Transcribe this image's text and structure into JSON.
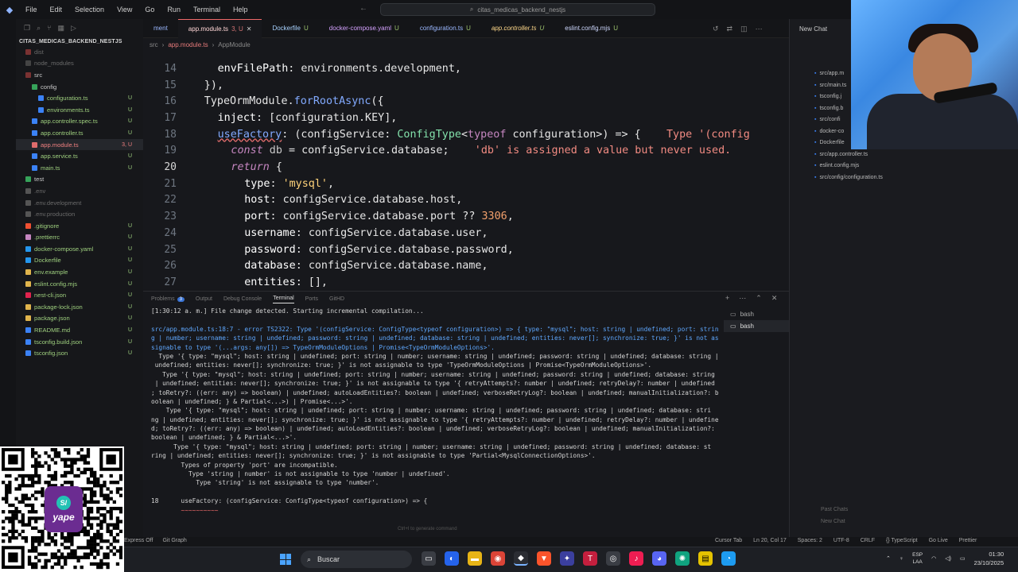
{
  "titlebar": {
    "menus": [
      "File",
      "Edit",
      "Selection",
      "View",
      "Go",
      "Run",
      "Terminal",
      "Help"
    ],
    "command_center": "citas_medicas_backend_nestjs"
  },
  "sidebar": {
    "project": "CITAS_MEDICAS_BACKEND_NESTJS",
    "items": [
      {
        "label": "dist",
        "status": "",
        "color": "#7a3232",
        "dim": true
      },
      {
        "label": "node_modules",
        "status": "",
        "color": "#444",
        "dim": true
      },
      {
        "label": "src",
        "status": "",
        "color": "#7a3232",
        "dim": false
      },
      {
        "label": "config",
        "status": "",
        "color": "#36a35a",
        "dim": false
      },
      {
        "label": "configuration.ts",
        "status": "U",
        "color": "#3b82f6",
        "dim": false
      },
      {
        "label": "environments.ts",
        "status": "U",
        "color": "#3b82f6",
        "dim": false
      },
      {
        "label": "app.controller.spec.ts",
        "status": "U",
        "color": "#3b82f6",
        "dim": false
      },
      {
        "label": "app.controller.ts",
        "status": "U",
        "color": "#3b82f6",
        "dim": false
      },
      {
        "label": "app.module.ts",
        "status": "3, U",
        "color": "#e06c6c",
        "dim": false
      },
      {
        "label": "app.service.ts",
        "status": "U",
        "color": "#3b82f6",
        "dim": false
      },
      {
        "label": "main.ts",
        "status": "U",
        "color": "#3b82f6",
        "dim": false
      },
      {
        "label": "test",
        "status": "",
        "color": "#36a35a",
        "dim": false
      },
      {
        "label": ".env",
        "status": "",
        "color": "#555",
        "dim": true
      },
      {
        "label": ".env.development",
        "status": "",
        "color": "#555",
        "dim": true
      },
      {
        "label": ".env.production",
        "status": "",
        "color": "#555",
        "dim": true
      },
      {
        "label": ".gitignore",
        "status": "U",
        "color": "#f05032",
        "dim": false
      },
      {
        "label": ".prettierrc",
        "status": "U",
        "color": "#c586c0",
        "dim": false
      },
      {
        "label": "docker-compose.yaml",
        "status": "U",
        "color": "#2496ed",
        "dim": false
      },
      {
        "label": "Dockerfile",
        "status": "U",
        "color": "#2496ed",
        "dim": false
      },
      {
        "label": "env.example",
        "status": "U",
        "color": "#e0b44c",
        "dim": false
      },
      {
        "label": "eslint.config.mjs",
        "status": "U",
        "color": "#e0b44c",
        "dim": false
      },
      {
        "label": "nest-cli.json",
        "status": "U",
        "color": "#e0234e",
        "dim": false
      },
      {
        "label": "package-lock.json",
        "status": "U",
        "color": "#e0b44c",
        "dim": false
      },
      {
        "label": "package.json",
        "status": "U",
        "color": "#e0b44c",
        "dim": false
      },
      {
        "label": "README.md",
        "status": "U",
        "color": "#3b82f6",
        "dim": false
      },
      {
        "label": "tsconfig.build.json",
        "status": "U",
        "color": "#3b82f6",
        "dim": false
      },
      {
        "label": "tsconfig.json",
        "status": "U",
        "color": "#3b82f6",
        "dim": false
      }
    ]
  },
  "tabs": [
    {
      "label": "ment",
      "status": "",
      "cls": "cfg"
    },
    {
      "label": "app.module.ts",
      "status": "3, U",
      "cls": "active"
    },
    {
      "label": "Dockerfile",
      "status": "U",
      "cls": "docker"
    },
    {
      "label": "docker-compose.yaml",
      "status": "U",
      "cls": "yaml"
    },
    {
      "label": "configuration.ts",
      "status": "U",
      "cls": "cfg"
    },
    {
      "label": "app.controller.ts",
      "status": "U",
      "cls": "ctrl"
    },
    {
      "label": "eslint.config.mjs",
      "status": "U",
      "cls": "eslint"
    }
  ],
  "breadcrumb": [
    "src",
    "app.module.ts",
    "AppModule"
  ],
  "editor": {
    "lines": [
      {
        "n": "14",
        "indent": 2,
        "tokens": [
          [
            "envFilePath",
            "pr"
          ],
          [
            ": ",
            "tx"
          ],
          [
            "environments",
            "tx"
          ],
          [
            ".",
            "tx"
          ],
          [
            "development",
            "tx"
          ],
          [
            ",",
            "tx"
          ]
        ]
      },
      {
        "n": "15",
        "indent": 1,
        "tokens": [
          [
            "}),",
            "tx"
          ]
        ]
      },
      {
        "n": "16",
        "indent": 1,
        "tokens": [
          [
            "TypeOrmModule",
            "tx"
          ],
          [
            ".",
            "tx"
          ],
          [
            "forRootAsync",
            "fn"
          ],
          [
            "({",
            "tx"
          ]
        ]
      },
      {
        "n": "17",
        "indent": 2,
        "tokens": [
          [
            "inject",
            "pr"
          ],
          [
            ": [",
            "tx"
          ],
          [
            "configuration",
            "tx"
          ],
          [
            ".",
            "tx"
          ],
          [
            "KEY",
            "tx"
          ],
          [
            "],",
            "tx"
          ]
        ]
      },
      {
        "n": "18",
        "indent": 2,
        "tokens": [
          [
            "useFactory",
            "fn"
          ],
          [
            ": (",
            "tx"
          ],
          [
            "configService",
            "tx"
          ],
          [
            ": ",
            "tx"
          ],
          [
            "ConfigType",
            "ty"
          ],
          [
            "<",
            "tx"
          ],
          [
            "typeof",
            "kw"
          ],
          [
            " configuration",
            ""
          ],
          [
            ">) => {",
            "tx"
          ],
          [
            "    Type '(config",
            "err"
          ]
        ]
      },
      {
        "n": "19",
        "indent": 3,
        "tokens": [
          [
            "const",
            "kw"
          ],
          [
            " db ",
            "dimt"
          ],
          [
            "= ",
            "tx"
          ],
          [
            "configService",
            "tx"
          ],
          [
            ".",
            "tx"
          ],
          [
            "database",
            "tx"
          ],
          [
            ";",
            "tx"
          ],
          [
            "    'db' is assigned a value but never used.",
            "err"
          ]
        ]
      },
      {
        "n": "20",
        "indent": 3,
        "tokens": [
          [
            "return",
            "kw"
          ],
          [
            " {",
            "tx"
          ]
        ]
      },
      {
        "n": "21",
        "indent": 4,
        "tokens": [
          [
            "type",
            "pr"
          ],
          [
            ": ",
            "tx"
          ],
          [
            "'mysql'",
            "st2"
          ],
          [
            ",",
            "tx"
          ]
        ]
      },
      {
        "n": "22",
        "indent": 4,
        "tokens": [
          [
            "host",
            "pr"
          ],
          [
            ": ",
            "tx"
          ],
          [
            "configService",
            "tx"
          ],
          [
            ".",
            "tx"
          ],
          [
            "database",
            "tx"
          ],
          [
            ".",
            "tx"
          ],
          [
            "host",
            "tx"
          ],
          [
            ",",
            "tx"
          ]
        ]
      },
      {
        "n": "23",
        "indent": 4,
        "tokens": [
          [
            "port",
            "pr"
          ],
          [
            ": ",
            "tx"
          ],
          [
            "configService",
            "tx"
          ],
          [
            ".",
            "tx"
          ],
          [
            "database",
            "tx"
          ],
          [
            ".",
            "tx"
          ],
          [
            "port",
            "tx"
          ],
          [
            " ?? ",
            "tx"
          ],
          [
            "3306",
            "nb"
          ],
          [
            ",",
            "tx"
          ]
        ]
      },
      {
        "n": "24",
        "indent": 4,
        "tokens": [
          [
            "username",
            "pr"
          ],
          [
            ": ",
            "tx"
          ],
          [
            "configService",
            "tx"
          ],
          [
            ".",
            "tx"
          ],
          [
            "database",
            "tx"
          ],
          [
            ".",
            "tx"
          ],
          [
            "user",
            "tx"
          ],
          [
            ",",
            "tx"
          ]
        ]
      },
      {
        "n": "25",
        "indent": 4,
        "tokens": [
          [
            "password",
            "pr"
          ],
          [
            ": ",
            "tx"
          ],
          [
            "configService",
            "tx"
          ],
          [
            ".",
            "tx"
          ],
          [
            "database",
            "tx"
          ],
          [
            ".",
            "tx"
          ],
          [
            "password",
            "tx"
          ],
          [
            ",",
            "tx"
          ]
        ]
      },
      {
        "n": "26",
        "indent": 4,
        "tokens": [
          [
            "database",
            "pr"
          ],
          [
            ": ",
            "tx"
          ],
          [
            "configService",
            "tx"
          ],
          [
            ".",
            "tx"
          ],
          [
            "database",
            "tx"
          ],
          [
            ".",
            "tx"
          ],
          [
            "name",
            "tx"
          ],
          [
            ",",
            "tx"
          ]
        ]
      },
      {
        "n": "27",
        "indent": 4,
        "tokens": [
          [
            "entities",
            "pr"
          ],
          [
            ": [],",
            "tx"
          ]
        ]
      }
    ]
  },
  "chat": {
    "new_chat": "New Chat",
    "files": [
      "src/app.m",
      "src/main.ts",
      "tsconfig.j",
      "tsconfig.b",
      "src/confi",
      "docker-co",
      "Dockerfile",
      "src/app.controller.ts",
      "eslint.config.mjs",
      "src/config/configuration.ts"
    ],
    "past_chats": "Past Chats",
    "new_chat_bottom": "New Chat"
  },
  "panel": {
    "tabs": [
      "Problems",
      "Output",
      "Debug Console",
      "Terminal",
      "Ports",
      "GitHD"
    ],
    "problems_count": "3",
    "active_tab": "Terminal",
    "terminals": [
      "bash",
      "bash"
    ],
    "terminal_lines": [
      {
        "t": "[1:30:12 a. m.] File change detected. Starting incremental compilation...",
        "c": ""
      },
      {
        "t": "",
        "c": ""
      },
      {
        "t": "src/app.module.ts:18:7 - error TS2322: Type '(configService: ConfigType<typeof configuration>) => { type: \"mysql\"; host: string | undefined; port: strin",
        "c": "err"
      },
      {
        "t": "g | number; username: string | undefined; password: string | undefined; database: string | undefined; entities: never[]; synchronize: true; }' is not as",
        "c": "blue"
      },
      {
        "t": "signable to type '(...args: any[]) => TypeOrmModuleOptions | Promise<TypeOrmModuleOptions>'.",
        "c": "blue"
      },
      {
        "t": "  Type '{ type: \"mysql\"; host: string | undefined; port: string | number; username: string | undefined; password: string | undefined; database: string |",
        "c": ""
      },
      {
        "t": " undefined; entities: never[]; synchronize: true; }' is not assignable to type 'TypeOrmModuleOptions | Promise<TypeOrmModuleOptions>'.",
        "c": ""
      },
      {
        "t": "   Type '{ type: \"mysql\"; host: string | undefined; port: string | number; username: string | undefined; password: string | undefined; database: string",
        "c": ""
      },
      {
        "t": " | undefined; entities: never[]; synchronize: true; }' is not assignable to type '{ retryAttempts?: number | undefined; retryDelay?: number | undefined",
        "c": ""
      },
      {
        "t": "; toRetry?: ((err: any) => boolean) | undefined; autoLoadEntities?: boolean | undefined; verboseRetryLog?: boolean | undefined; manualInitialization?: b",
        "c": ""
      },
      {
        "t": "oolean | undefined; } & Partial<...>) | Promise<...>'.",
        "c": ""
      },
      {
        "t": "    Type '{ type: \"mysql\"; host: string | undefined; port: string | number; username: string | undefined; password: string | undefined; database: stri",
        "c": ""
      },
      {
        "t": "ng | undefined; entities: never[]; synchronize: true; }' is not assignable to type '{ retryAttempts?: number | undefined; retryDelay?: number | undefine",
        "c": ""
      },
      {
        "t": "d; toRetry?: ((err: any) => boolean) | undefined; autoLoadEntities?: boolean | undefined; verboseRetryLog?: boolean | undefined; manualInitialization?:",
        "c": ""
      },
      {
        "t": "boolean | undefined; } & Partial<...>'.",
        "c": ""
      },
      {
        "t": "      Type '{ type: \"mysql\"; host: string | undefined; port: string | number; username: string | undefined; password: string | undefined; database: st",
        "c": ""
      },
      {
        "t": "ring | undefined; entities: never[]; synchronize: true; }' is not assignable to type 'Partial<MysqlConnectionOptions>'.",
        "c": ""
      },
      {
        "t": "        Types of property 'port' are incompatible.",
        "c": ""
      },
      {
        "t": "          Type 'string | number' is not assignable to type 'number | undefined'.",
        "c": ""
      },
      {
        "t": "            Type 'string' is not assignable to type 'number'.",
        "c": ""
      },
      {
        "t": "",
        "c": ""
      },
      {
        "t": "18      useFactory: (configService: ConfigType<typeof configuration>) => {",
        "c": ""
      },
      {
        "t": "        ~~~~~~~~~~",
        "c": "err"
      }
    ],
    "hint": "Ctrl+I to generate command"
  },
  "statusbar": {
    "left": [
      "Express Off",
      "Git Graph"
    ],
    "right": [
      "Cursor Tab",
      "Ln 20, Col 17",
      "Spaces: 2",
      "UTF-8",
      "CRLF",
      "{} TypeScript",
      "Go Live",
      "Prettier"
    ]
  },
  "taskbar": {
    "search": "Buscar",
    "lang": "ESP",
    "lang2": "LAA",
    "time": "01:30",
    "date": "23/10/2025"
  },
  "qr": {
    "brand": "yape"
  }
}
